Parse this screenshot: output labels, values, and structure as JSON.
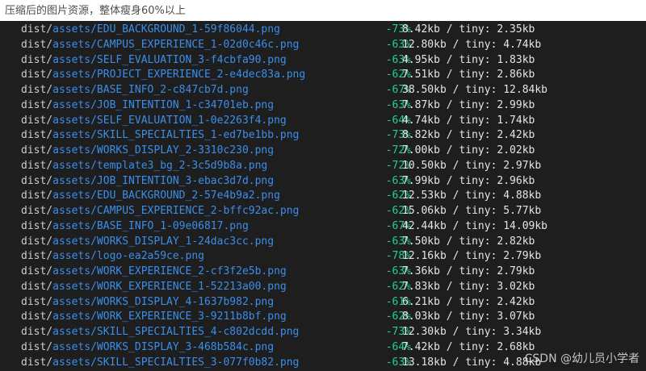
{
  "caption": "压缩后的图片资源，整体瘦身60%以上",
  "watermark": "CSDN @幼儿员小学者",
  "colors": {
    "background": "#1e1e1e",
    "dist": "#cccccc",
    "file_path": "#3b8eea",
    "percent": "#23d18b",
    "sizes": "#e5e5e5"
  },
  "rows": [
    {
      "dist": "dist/",
      "file": "assets/EDU_BACKGROUND_1-59f86044.png",
      "pct": "-73%",
      "sizes": "8.42kb / tiny: 2.35kb"
    },
    {
      "dist": "dist/",
      "file": "assets/CAMPUS_EXPERIENCE_1-02d0c46c.png",
      "pct": "-63%",
      "sizes": "12.80kb / tiny: 4.74kb"
    },
    {
      "dist": "dist/",
      "file": "assets/SELF_EVALUATION_3-f4cbfa90.png",
      "pct": "-63%",
      "sizes": "4.95kb / tiny: 1.83kb"
    },
    {
      "dist": "dist/",
      "file": "assets/PROJECT_EXPERIENCE_2-e4dec83a.png",
      "pct": "-62%",
      "sizes": "7.51kb / tiny: 2.86kb"
    },
    {
      "dist": "dist/",
      "file": "assets/BASE_INFO_2-c847cb7d.png",
      "pct": "-67%",
      "sizes": "38.50kb / tiny: 12.84kb"
    },
    {
      "dist": "dist/",
      "file": "assets/JOB_INTENTION_1-c34701eb.png",
      "pct": "-63%",
      "sizes": "7.87kb / tiny: 2.99kb"
    },
    {
      "dist": "dist/",
      "file": "assets/SELF_EVALUATION_1-0e2263f4.png",
      "pct": "-64%",
      "sizes": "4.74kb / tiny: 1.74kb"
    },
    {
      "dist": "dist/",
      "file": "assets/SKILL_SPECIALTIES_1-ed7be1bb.png",
      "pct": "-73%",
      "sizes": "8.82kb / tiny: 2.42kb"
    },
    {
      "dist": "dist/",
      "file": "assets/WORKS_DISPLAY_2-3310c230.png",
      "pct": "-72%",
      "sizes": "7.00kb / tiny: 2.02kb"
    },
    {
      "dist": "dist/",
      "file": "assets/template3_bg_2-3c5d9b8a.png",
      "pct": "-72%",
      "sizes": "10.50kb / tiny: 2.97kb"
    },
    {
      "dist": "dist/",
      "file": "assets/JOB_INTENTION_3-ebac3d7d.png",
      "pct": "-63%",
      "sizes": "7.99kb / tiny: 2.96kb"
    },
    {
      "dist": "dist/",
      "file": "assets/EDU_BACKGROUND_2-57e4b9a2.png",
      "pct": "-62%",
      "sizes": "12.53kb / tiny: 4.88kb"
    },
    {
      "dist": "dist/",
      "file": "assets/CAMPUS_EXPERIENCE_2-bffc92ac.png",
      "pct": "-62%",
      "sizes": "15.06kb / tiny: 5.77kb"
    },
    {
      "dist": "dist/",
      "file": "assets/BASE_INFO_1-09e06817.png",
      "pct": "-67%",
      "sizes": "42.44kb / tiny: 14.09kb"
    },
    {
      "dist": "dist/",
      "file": "assets/WORKS_DISPLAY_1-24dac3cc.png",
      "pct": "-63%",
      "sizes": "7.50kb / tiny: 2.82kb"
    },
    {
      "dist": "dist/",
      "file": "assets/logo-ea2a59ce.png",
      "pct": "-78%",
      "sizes": "12.16kb / tiny: 2.79kb"
    },
    {
      "dist": "dist/",
      "file": "assets/WORK_EXPERIENCE_2-cf3f2e5b.png",
      "pct": "-63%",
      "sizes": "7.36kb / tiny: 2.79kb"
    },
    {
      "dist": "dist/",
      "file": "assets/WORK_EXPERIENCE_1-52213a00.png",
      "pct": "-62%",
      "sizes": "7.83kb / tiny: 3.02kb"
    },
    {
      "dist": "dist/",
      "file": "assets/WORKS_DISPLAY_4-1637b982.png",
      "pct": "-61%",
      "sizes": "6.21kb / tiny: 2.42kb"
    },
    {
      "dist": "dist/",
      "file": "assets/WORK_EXPERIENCE_3-9211b8bf.png",
      "pct": "-62%",
      "sizes": "8.03kb / tiny: 3.07kb"
    },
    {
      "dist": "dist/",
      "file": "assets/SKILL_SPECIALTIES_4-c802dcdd.png",
      "pct": "-73%",
      "sizes": "12.30kb / tiny: 3.34kb"
    },
    {
      "dist": "dist/",
      "file": "assets/WORKS_DISPLAY_3-468b584c.png",
      "pct": "-64%",
      "sizes": "7.42kb / tiny: 2.68kb"
    },
    {
      "dist": "dist/",
      "file": "assets/SKILL_SPECIALTIES_3-077f0b82.png",
      "pct": "-63%",
      "sizes": "13.18kb / tiny: 4.88kb"
    }
  ]
}
